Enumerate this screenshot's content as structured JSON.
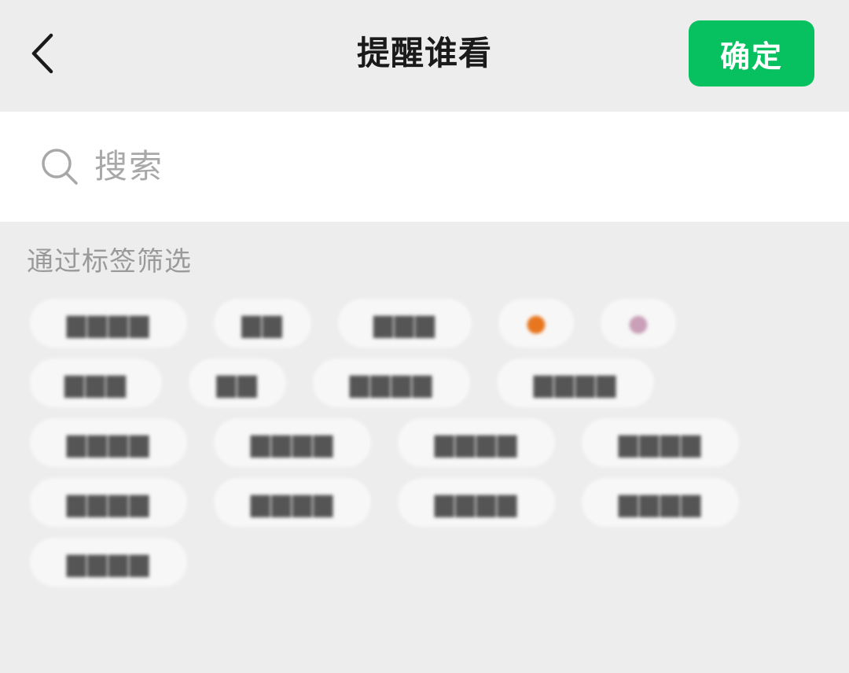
{
  "header": {
    "title": "提醒谁看",
    "confirm_label": "确定"
  },
  "search": {
    "placeholder": "搜索"
  },
  "filter": {
    "label": "通过标签筛选"
  },
  "colors": {
    "accent": "#07c160",
    "background": "#ededed",
    "tag_bg": "#f7f7f7"
  },
  "icons": {
    "back": "chevron-left-icon",
    "search": "search-icon"
  }
}
